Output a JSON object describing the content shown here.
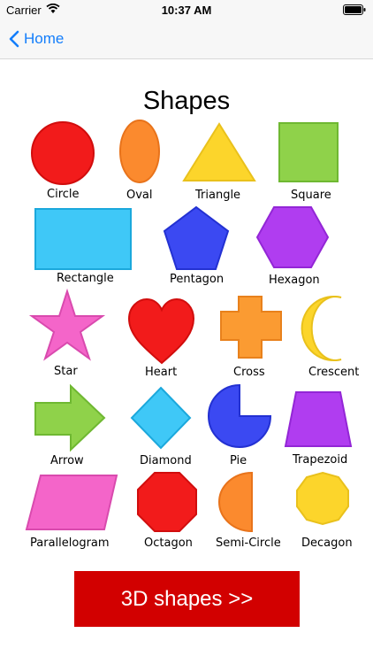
{
  "status_bar": {
    "carrier": "Carrier",
    "time": "10:37 AM"
  },
  "nav": {
    "back_label": "Home"
  },
  "poster": {
    "title": "Shapes",
    "labels": {
      "circle": "Circle",
      "oval": "Oval",
      "triangle": "Triangle",
      "square": "Square",
      "rectangle": "Rectangle",
      "pentagon": "Pentagon",
      "hexagon": "Hexagon",
      "star": "Star",
      "heart": "Heart",
      "cross": "Cross",
      "crescent": "Crescent",
      "arrow": "Arrow",
      "diamond": "Diamond",
      "pie": "Pie",
      "trapezoid": "Trapezoid",
      "parallelogram": "Parallelogram",
      "octagon": "Octagon",
      "semicircle": "Semi-Circle",
      "decagon": "Decagon"
    },
    "colors": {
      "red": "#f21b1b",
      "orange": "#fb8a2e",
      "yellow": "#fcd52b",
      "green": "#8fd24a",
      "cyan": "#3fc8f7",
      "blue": "#3b49f2",
      "purple": "#b03df0",
      "pink": "#f465c9"
    }
  },
  "button": {
    "label": "3D shapes >>"
  }
}
